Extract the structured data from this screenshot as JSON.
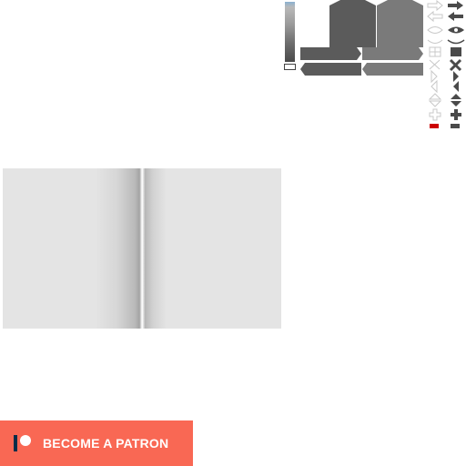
{
  "patreon": {
    "label": "BECOME A PATRON",
    "background": "#f96854",
    "logo_bar": "#052d49"
  },
  "book": {
    "page_color": "#e4e4e4"
  },
  "icon_sprites": {
    "light_set": [
      "arrow-right-icon",
      "arrow-left-icon",
      "eye-icon",
      "closed-eye-icon",
      "grid-icon",
      "close-x-icon",
      "triangle-left-icon",
      "triangle-right-icon",
      "up-down-icon",
      "plus-icon",
      "red-swatch-icon"
    ],
    "dark_set": [
      "arrow-right-icon",
      "arrow-left-icon",
      "eye-icon",
      "closed-eye-icon",
      "grid-icon",
      "close-x-icon",
      "triangle-right-icon",
      "triangle-left-icon",
      "up-down-icon",
      "plus-icon",
      "minus-icon"
    ],
    "accent_red": "#cc0000"
  }
}
